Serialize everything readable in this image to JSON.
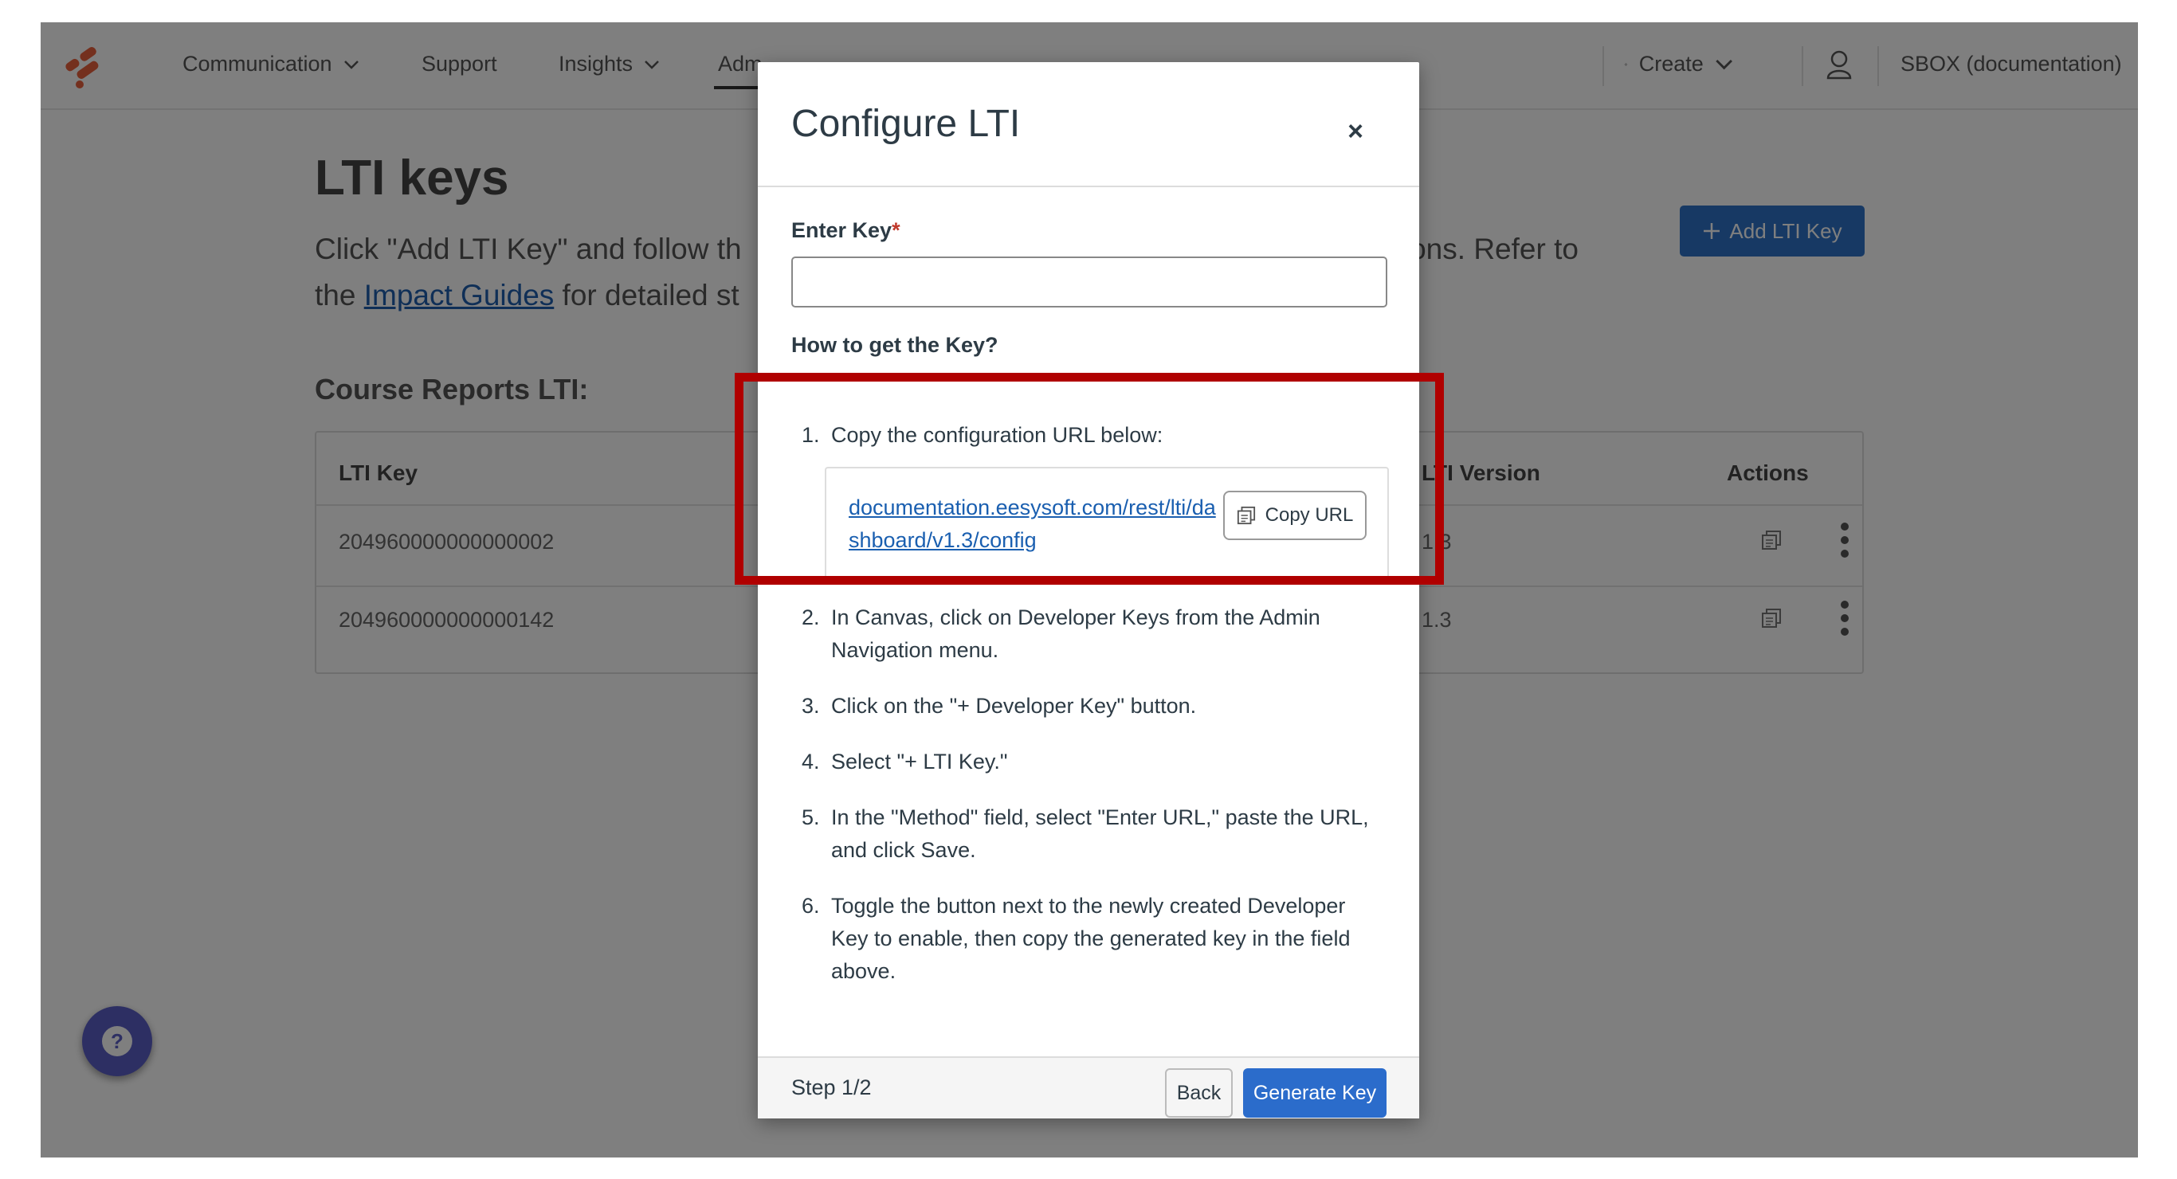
{
  "nav": {
    "items": [
      {
        "label": "Communication",
        "has_dropdown": true
      },
      {
        "label": "Support",
        "has_dropdown": false
      },
      {
        "label": "Insights",
        "has_dropdown": true
      },
      {
        "label": "Adm",
        "has_dropdown": false,
        "active": true
      }
    ],
    "create_label": "Create",
    "account_label": "SBOX (documentation)",
    "icons": [
      "logo-icon",
      "chevron-down-icon",
      "plus-icon",
      "user-icon"
    ]
  },
  "page": {
    "title": "LTI keys",
    "desc_line1_a": "Click \"Add LTI Key\" and follow th",
    "desc_line1_b": "tions. Refer to",
    "desc_line2_a": "the ",
    "desc_link": "Impact Guides",
    "desc_line2_b": " for detailed st",
    "add_button": "Add LTI Key",
    "section_title": "Course Reports LTI:"
  },
  "table": {
    "columns": {
      "key": "LTI Key",
      "version": "LTI Version",
      "actions": "Actions"
    },
    "rows": [
      {
        "key": "204960000000000002",
        "version": "1.3"
      },
      {
        "key": "204960000000000142",
        "version": "1.3"
      }
    ]
  },
  "modal": {
    "title": "Configure LTI",
    "close_symbol": "×",
    "field_label": "Enter Key",
    "required_marker": "*",
    "key_value": "",
    "how_label": "How to get the Key?",
    "steps": [
      {
        "num": "1.",
        "text": "Copy the configuration URL below:"
      },
      {
        "num": "2.",
        "text": "In Canvas, click on Developer Keys from the Admin Navigation menu."
      },
      {
        "num": "3.",
        "text": "Click on the \"+ Developer Key\" button."
      },
      {
        "num": "4.",
        "text": "Select \"+ LTI Key.\""
      },
      {
        "num": "5.",
        "text": "In the \"Method\" field, select \"Enter URL,\" paste the URL, and click Save."
      },
      {
        "num": "6.",
        "text": "Toggle the button next to the newly created Developer Key to enable, then copy the generated key in the field above."
      }
    ],
    "config_url": "documentation.eesysoft.com/rest/lti/dashboard/v1.3/config",
    "copy_url_label": "Copy URL",
    "step_label": "Step 1/2",
    "back_label": "Back",
    "generate_label": "Generate Key"
  },
  "colors": {
    "primary": "#2b6ccb",
    "highlight_border": "#b00000",
    "help_button": "#5b5fc7"
  }
}
